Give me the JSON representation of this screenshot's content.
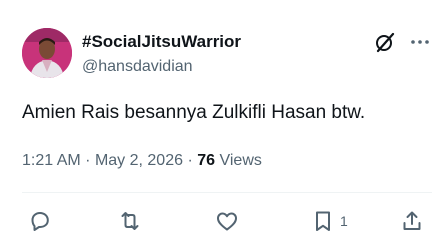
{
  "tweet": {
    "author_name": "#SocialJitsuWarrior",
    "author_handle": "@hansdavidian",
    "text": "Amien Rais besannya Zulkifli Hasan btw.",
    "time": "1:21 AM",
    "separator": "·",
    "date": "May 2, 2026",
    "views_count": "76",
    "views_label": "Views"
  },
  "actions": {
    "reply_icon": "reply-bubble-icon",
    "repost_icon": "repost-arrows-icon",
    "like_icon": "heart-icon",
    "bookmark_icon": "bookmark-icon",
    "bookmark_count": "1",
    "share_icon": "share-upload-icon"
  },
  "header_icons": {
    "grok": "grok-slash-circle-icon",
    "more": "more-dots-icon"
  },
  "colors": {
    "text": "#0f1419",
    "secondary": "#536471",
    "avatar_bg": "#c8337a"
  }
}
